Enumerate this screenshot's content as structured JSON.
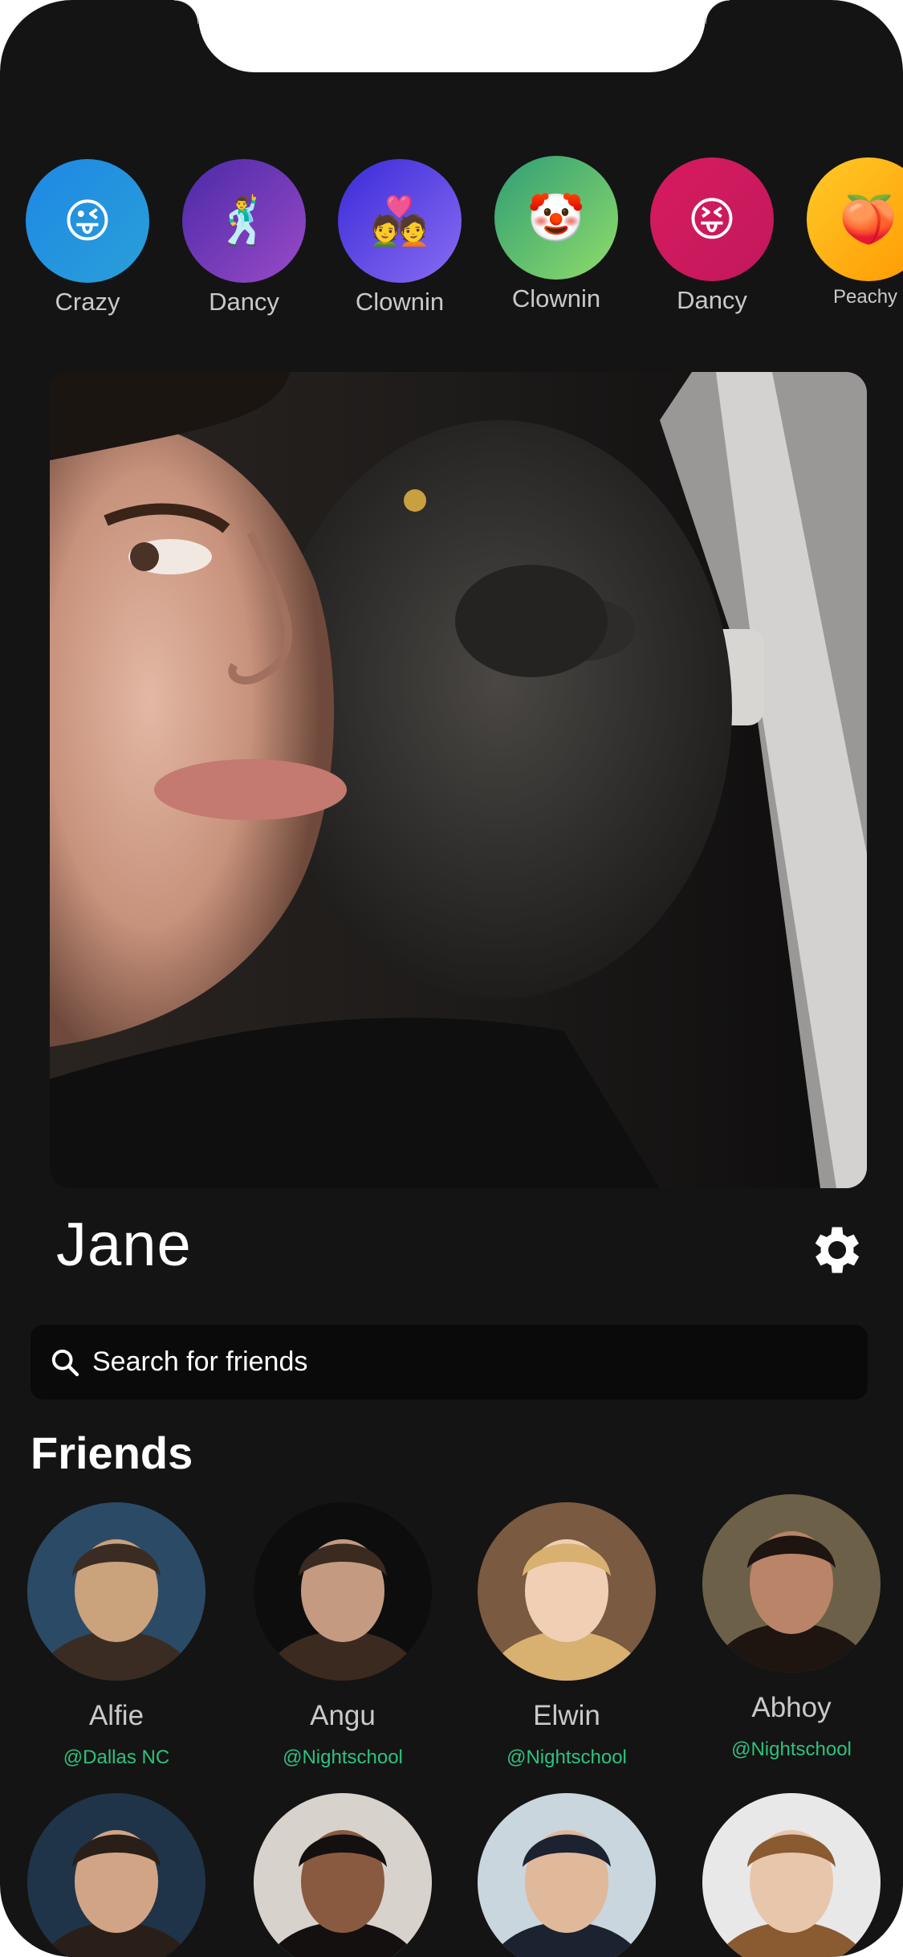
{
  "stories": [
    {
      "label": "Crazy",
      "emoji": "😜",
      "icon": "crazy-face-icon",
      "gradient": [
        "#1e88e5",
        "#2a9fd8"
      ]
    },
    {
      "label": "Dancy",
      "emoji": "🕺",
      "icon": "dancing-man-icon",
      "gradient": [
        "#4a2aa8",
        "#9a4ac7"
      ]
    },
    {
      "label": "Clownin",
      "emoji": "💑",
      "icon": "couple-heart-icon",
      "gradient": [
        "#3a2bd8",
        "#8a6cf2"
      ]
    },
    {
      "label": "Clownin",
      "emoji": "🤡",
      "icon": "clown-face-icon",
      "gradient": [
        "#2f9d75",
        "#8fdc6a"
      ]
    },
    {
      "label": "Dancy",
      "emoji": "😝",
      "icon": "tongue-face-icon",
      "gradient": [
        "#d81b60",
        "#c2185b"
      ]
    },
    {
      "label": "Peachy",
      "emoji": "🍑",
      "icon": "peach-icon",
      "gradient": [
        "#ffca28",
        "#ff9800"
      ]
    }
  ],
  "profile": {
    "name": "Jane"
  },
  "search": {
    "placeholder": "Search for friends"
  },
  "friends_section": {
    "title": "Friends"
  },
  "friends": [
    {
      "name": "Alfie",
      "handle": "@Dallas NC",
      "palette": [
        "#2b4a66",
        "#caa27c",
        "#3a2c22"
      ]
    },
    {
      "name": "Angu",
      "handle": "@Nightschool",
      "palette": [
        "#0d0d0d",
        "#c49a80",
        "#3b2a20"
      ]
    },
    {
      "name": "Elwin",
      "handle": "@Nightschool",
      "palette": [
        "#7a5a40",
        "#f0cfb4",
        "#d8b070"
      ]
    },
    {
      "name": "Abhoy",
      "handle": "@Nightschool",
      "palette": [
        "#6c6048",
        "#b98468",
        "#1e1410"
      ]
    },
    {
      "name": "",
      "handle": "",
      "palette": [
        "#1f3448",
        "#d2a486",
        "#2a1f18"
      ]
    },
    {
      "name": "",
      "handle": "",
      "palette": [
        "#d8d2cc",
        "#8a5a40",
        "#141010"
      ]
    },
    {
      "name": "",
      "handle": "",
      "palette": [
        "#c9d6de",
        "#e0b89a",
        "#1c2230"
      ]
    },
    {
      "name": "",
      "handle": "",
      "palette": [
        "#e8e8e8",
        "#e8c6ac",
        "#8a5a30"
      ]
    }
  ],
  "colors": {
    "background": "#141414",
    "handle": "#2ec27e",
    "label": "#c9c9c9"
  }
}
